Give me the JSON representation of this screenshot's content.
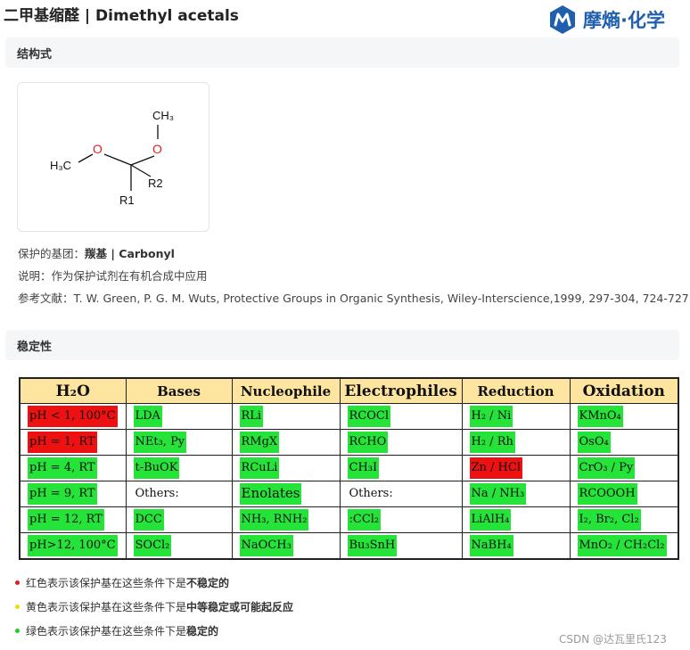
{
  "page": {
    "title": "二甲基缩醛 | Dimethyl acetals",
    "logo_text": "摩熵·化学"
  },
  "sections": {
    "structure": "结构式",
    "stability": "稳定性"
  },
  "structure_labels": {
    "ch3_top": "CH₃",
    "o1": "O",
    "o2": "O",
    "h3c": "H₃C",
    "r2": "R2",
    "r1": "R1"
  },
  "info": {
    "protect_label": "保护的基团：",
    "protect_value": "羰基 | Carbonyl",
    "desc_label": "说明：",
    "desc_value": "作为保护试剂在有机合成中应用",
    "ref_label": "参考文献：",
    "ref_value": "T. W. Green, P. G. M. Wuts, Protective Groups in Organic Synthesis, Wiley-Interscience,1999, 297-304, 724-727."
  },
  "table": {
    "headers": [
      "H₂O",
      "Bases",
      "Nucleophile",
      "Electrophiles",
      "Reduction",
      "Oxidation"
    ],
    "rows": [
      [
        {
          "t": "pH < 1, 100°C",
          "c": "r"
        },
        {
          "t": "LDA",
          "c": "g"
        },
        {
          "t": "RLi",
          "c": "g"
        },
        {
          "t": "RCOCl",
          "c": "g"
        },
        {
          "t": "H₂ / Ni",
          "c": "g"
        },
        {
          "t": "KMnO₄",
          "c": "g"
        }
      ],
      [
        {
          "t": "pH = 1, RT",
          "c": "r"
        },
        {
          "t": "NEt₃, Py",
          "c": "g"
        },
        {
          "t": "RMgX",
          "c": "g"
        },
        {
          "t": "RCHO",
          "c": "g"
        },
        {
          "t": "H₂ / Rh",
          "c": "g"
        },
        {
          "t": "OsO₄",
          "c": "g"
        }
      ],
      [
        {
          "t": "pH = 4, RT",
          "c": "g"
        },
        {
          "t": "t-BuOK",
          "c": "g"
        },
        {
          "t": "RCuLi",
          "c": "g"
        },
        {
          "t": "CH₃I",
          "c": "g"
        },
        {
          "t": "Zn / HCl",
          "c": "r"
        },
        {
          "t": "CrO₃ / Py",
          "c": "g"
        }
      ],
      [
        {
          "t": "pH = 9, RT",
          "c": "g"
        },
        {
          "t": "Others:",
          "c": "n"
        },
        {
          "t": "Enolates",
          "c": "g"
        },
        {
          "t": "Others:",
          "c": "n"
        },
        {
          "t": "Na / NH₃",
          "c": "g"
        },
        {
          "t": "RCOOOH",
          "c": "g"
        }
      ],
      [
        {
          "t": "pH = 12, RT",
          "c": "g"
        },
        {
          "t": "DCC",
          "c": "g"
        },
        {
          "t": "NH₃, RNH₂",
          "c": "g"
        },
        {
          "t": ":CCl₂",
          "c": "g"
        },
        {
          "t": "LiAlH₄",
          "c": "g"
        },
        {
          "t": "I₂, Br₂, Cl₂",
          "c": "g"
        }
      ],
      [
        {
          "t": "pH>12, 100°C",
          "c": "g"
        },
        {
          "t": "SOCl₂",
          "c": "g"
        },
        {
          "t": "NaOCH₃",
          "c": "g"
        },
        {
          "t": "Bu₃SnH",
          "c": "g"
        },
        {
          "t": "NaBH₄",
          "c": "g"
        },
        {
          "t": "MnO₂ / CH₂Cl₂",
          "c": "g"
        }
      ]
    ]
  },
  "legend": [
    {
      "color": "#e02020",
      "prefix": "红色表示该保护基在这些条件下是",
      "strong": "不稳定的"
    },
    {
      "color": "#f5d90a",
      "prefix": "黄色表示该保护基在这些条件下是",
      "strong": "中等稳定或可能起反应"
    },
    {
      "color": "#22cc22",
      "prefix": "绿色表示该保护基在这些条件下是",
      "strong": "稳定的"
    }
  ],
  "watermark": "CSDN @达瓦里氏123",
  "colors": {
    "stable": "#26e33a",
    "unstable": "#ee1111",
    "header": "#fde49f",
    "logo": "#1f5fae"
  }
}
